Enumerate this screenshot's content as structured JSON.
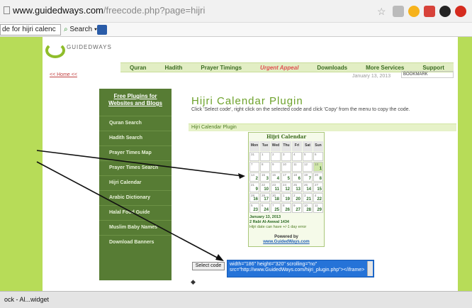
{
  "browser": {
    "url_domain": "www.guidedways.com",
    "url_path": "/freecode.php?page=hijri",
    "toolbar_search_value": "de for hijri calenc",
    "toolbar_search_button": "Search"
  },
  "site": {
    "logo_text": "GUIDEDWAYS",
    "nav": [
      "Quran",
      "Hadith",
      "Prayer Timings",
      "Urgent Appeal",
      "Downloads",
      "More Services",
      "Support"
    ],
    "home_link": "<< Home <<",
    "date": "January 13, 2013",
    "bookmark_label": "BOOKMARK"
  },
  "sidebar": {
    "heading": "Free Plugins for Websites and Blogs",
    "items": [
      "Quran Search",
      "Hadith Search",
      "Prayer Times Map",
      "Prayer Times Search",
      "Hijri Calendar",
      "Arabic Dictionary",
      "Halal Food Guide",
      "Muslim Baby Names",
      "Download Banners"
    ]
  },
  "main": {
    "title": "Hijri Calendar Plugin",
    "description": "Click 'Select code', right click on the selected code and click 'Copy' from the menu to copy the code.",
    "plugin_label": "Hijri Calendar Plugin",
    "select_code_label": "Select code",
    "code_text": "width=\"186\" height=\"320\" scrolling=\"no\"\nsrc=\"http://www.GuidedWays.com/hijri_plugin.php\"></iframe>"
  },
  "calendar": {
    "title": "Hijri Calendar",
    "days": [
      "Mon",
      "Tue",
      "Wed",
      "Thu",
      "Fri",
      "Sat",
      "Sun"
    ],
    "weeks": [
      [
        {
          "h": "31",
          "g": ""
        },
        {
          "h": "1",
          "g": ""
        },
        {
          "h": "2",
          "g": ""
        },
        {
          "h": "3",
          "g": ""
        },
        {
          "h": "4",
          "g": ""
        },
        {
          "h": "5",
          "g": ""
        },
        {
          "h": "6",
          "g": ""
        }
      ],
      [
        {
          "h": "7",
          "g": ""
        },
        {
          "h": "8",
          "g": ""
        },
        {
          "h": "9",
          "g": ""
        },
        {
          "h": "10",
          "g": ""
        },
        {
          "h": "11",
          "g": ""
        },
        {
          "h": "12",
          "g": ""
        },
        {
          "h": "13",
          "g": "1",
          "t": true
        }
      ],
      [
        {
          "h": "14",
          "g": "2"
        },
        {
          "h": "15",
          "g": "3"
        },
        {
          "h": "16",
          "g": "4"
        },
        {
          "h": "17",
          "g": "5"
        },
        {
          "h": "18",
          "g": "6"
        },
        {
          "h": "19",
          "g": "7"
        },
        {
          "h": "20",
          "g": "8"
        }
      ],
      [
        {
          "h": "21",
          "g": "9"
        },
        {
          "h": "22",
          "g": "10"
        },
        {
          "h": "23",
          "g": "11"
        },
        {
          "h": "24",
          "g": "12"
        },
        {
          "h": "25",
          "g": "13"
        },
        {
          "h": "26",
          "g": "14"
        },
        {
          "h": "27",
          "g": "15"
        }
      ],
      [
        {
          "h": "28",
          "g": "16"
        },
        {
          "h": "29",
          "g": "17"
        },
        {
          "h": "30",
          "g": "18"
        },
        {
          "h": "1",
          "g": "19"
        },
        {
          "h": "2",
          "g": "20"
        },
        {
          "h": "3",
          "g": "21"
        },
        {
          "h": "4",
          "g": "22"
        }
      ],
      [
        {
          "h": "5",
          "g": "23"
        },
        {
          "h": "6",
          "g": "24"
        },
        {
          "h": "7",
          "g": "25"
        },
        {
          "h": "8",
          "g": "26"
        },
        {
          "h": "9",
          "g": "27"
        },
        {
          "h": "10",
          "g": "28"
        },
        {
          "h": "11",
          "g": "29"
        }
      ]
    ],
    "foot_date": "January 13, 2013",
    "foot_hijri": "2 Rabi Al-Awwal 1434",
    "foot_note": "Hijri date can have +/-1 day error",
    "powered_by": "Powered by",
    "powered_url": "www.GuidedWays.com"
  },
  "taskbar": {
    "item": "ock - Al...widget"
  },
  "colors": {
    "page_green": "#b7dc58",
    "sidebar_green": "#577c34",
    "code_selection_blue": "#2573d8"
  }
}
